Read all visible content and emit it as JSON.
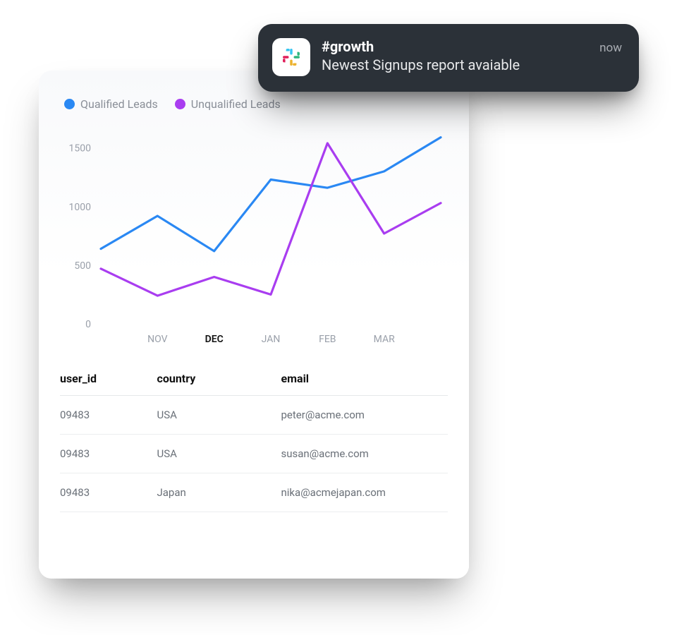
{
  "notification": {
    "title": "#growth",
    "message": "Newest Signups report avaiable",
    "time": "now"
  },
  "legend": {
    "qualified_label": "Qualified Leads",
    "unqualified_label": "Unqualified Leads",
    "qualified_color": "#2a88f3",
    "unqualified_color": "#a93df0"
  },
  "chart_data": {
    "type": "line",
    "xlabel": "",
    "ylabel": "",
    "ylim": [
      0,
      1600
    ],
    "y_ticks": [
      0,
      500,
      1000,
      1500
    ],
    "categories": [
      "",
      "NOV",
      "DEC",
      "JAN",
      "FEB",
      "MAR",
      ""
    ],
    "active_category": "DEC",
    "series": [
      {
        "name": "Qualified Leads",
        "color": "#2a88f3",
        "values": [
          640,
          920,
          620,
          1230,
          1160,
          1300,
          1590
        ]
      },
      {
        "name": "Unqualified Leads",
        "color": "#a93df0",
        "values": [
          470,
          240,
          400,
          250,
          1540,
          770,
          1030
        ]
      }
    ]
  },
  "table": {
    "columns": {
      "user_id": "user_id",
      "country": "country",
      "email": "email"
    },
    "rows": [
      {
        "user_id": "09483",
        "country": "USA",
        "email": "peter@acme.com"
      },
      {
        "user_id": "09483",
        "country": "USA",
        "email": "susan@acme.com"
      },
      {
        "user_id": "09483",
        "country": "Japan",
        "email": "nika@acmejapan.com"
      }
    ]
  }
}
